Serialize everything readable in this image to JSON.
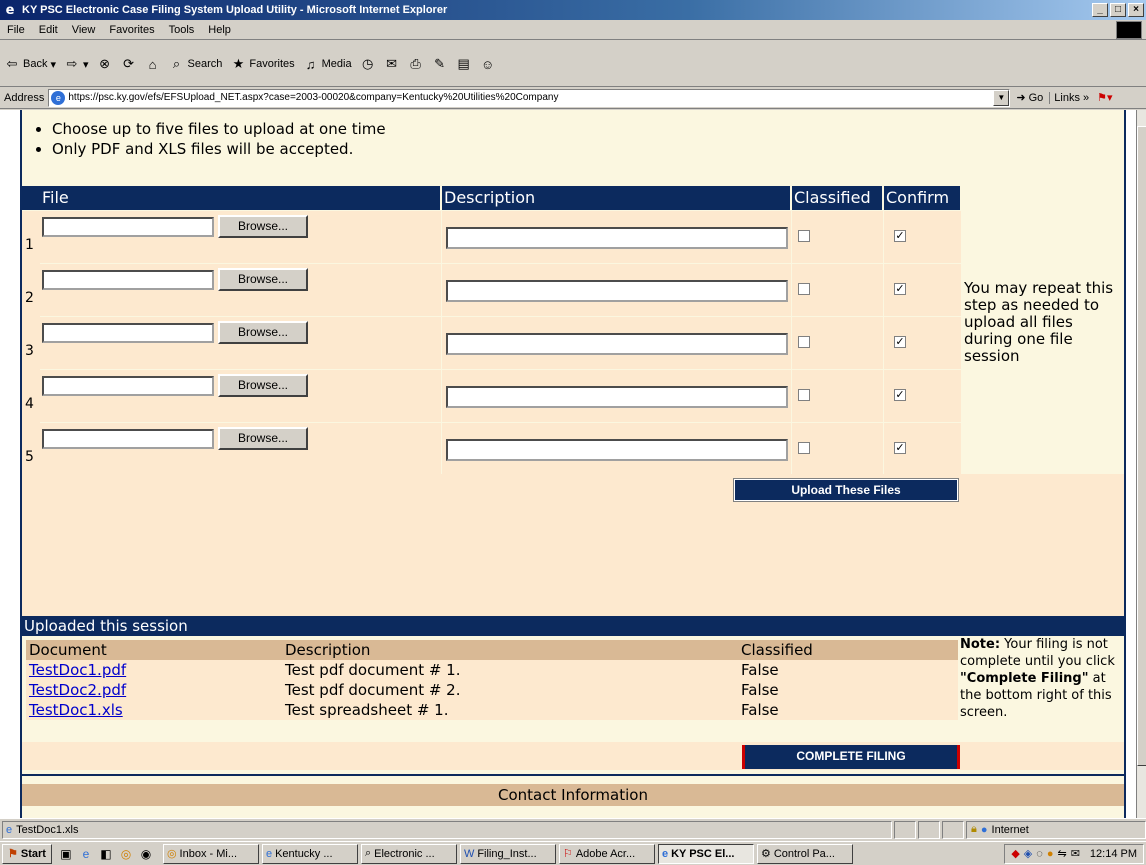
{
  "window": {
    "title": "KY PSC Electronic Case Filing System Upload Utility - Microsoft Internet Explorer",
    "controls": [
      "_",
      "□",
      "×"
    ]
  },
  "menu": [
    "File",
    "Edit",
    "View",
    "Favorites",
    "Tools",
    "Help"
  ],
  "toolbar": {
    "back": "Back",
    "search": "Search",
    "favorites": "Favorites",
    "media": "Media"
  },
  "address": {
    "label": "Address",
    "url": "https://psc.ky.gov/efs/EFSUpload_NET.aspx?case=2003-00020&company=Kentucky%20Utilities%20Company",
    "go": "Go",
    "links": "Links"
  },
  "instructions": [
    "Choose up to five files to upload at one time",
    "Only PDF and XLS files will be accepted."
  ],
  "upload_table": {
    "headers": {
      "file": "File",
      "description": "Description",
      "classified": "Classified",
      "confirm": "Confirm"
    },
    "browse_label": "Browse...",
    "rows": [
      {
        "num": "1",
        "classified": false,
        "confirm": true
      },
      {
        "num": "2",
        "classified": false,
        "confirm": true
      },
      {
        "num": "3",
        "classified": false,
        "confirm": true
      },
      {
        "num": "4",
        "classified": false,
        "confirm": true
      },
      {
        "num": "5",
        "classified": false,
        "confirm": true
      }
    ],
    "side_note": "You may repeat this step as needed to upload all files during one file session",
    "upload_button": "Upload These Files"
  },
  "session": {
    "title": "Uploaded this session",
    "headers": {
      "document": "Document",
      "description": "Description",
      "classified": "Classified"
    },
    "rows": [
      {
        "document": "TestDoc1.pdf",
        "description": "Test pdf document # 1.",
        "classified": "False"
      },
      {
        "document": "TestDoc2.pdf",
        "description": "Test pdf document # 2.",
        "classified": "False"
      },
      {
        "document": "TestDoc1.xls",
        "description": "Test spreadsheet # 1.",
        "classified": "False"
      }
    ],
    "note_label": "Note:",
    "note_text_1": " Your filing is not complete until you click ",
    "note_strong": "\"Complete Filing\"",
    "note_text_2": " at the bottom right of this screen.",
    "complete_button": "COMPLETE FILING"
  },
  "contact": {
    "title": "Contact Information"
  },
  "status": {
    "text": "TestDoc1.xls",
    "zone": "Internet"
  },
  "taskbar": {
    "start": "Start",
    "tasks": [
      {
        "label": "Inbox - Mi...",
        "active": false
      },
      {
        "label": "Kentucky ...",
        "active": false
      },
      {
        "label": "Electronic ...",
        "active": false
      },
      {
        "label": "Filing_Inst...",
        "active": false
      },
      {
        "label": "Adobe Acr...",
        "active": false
      },
      {
        "label": "KY PSC El...",
        "active": true
      },
      {
        "label": "Control Pa...",
        "active": false
      }
    ],
    "clock": "12:14 PM"
  }
}
